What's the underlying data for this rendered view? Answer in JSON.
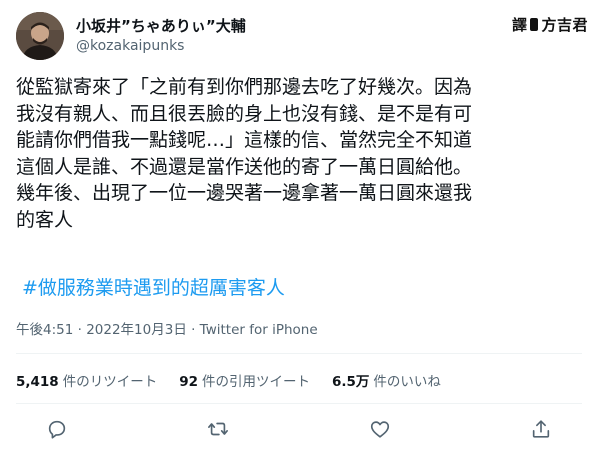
{
  "author": {
    "display_name": "小坂井”ちゃありぃ”大輔",
    "handle": "@kozakaipunks",
    "avatar_icon": "avatar-photo"
  },
  "watermark": {
    "prefix": "譯",
    "name": "方吉君"
  },
  "tweet": {
    "lines": [
      "從監獄寄來了「之前有到你們那邊去吃了好幾次。因為",
      "我沒有親人、而且很丟臉的身上也沒有錢、是不是有可",
      "能請你們借我一點錢呢…」這樣的信、當然完全不知道",
      "這個人是誰、不過還是當作送他的寄了一萬日圓給他。",
      "幾年後、出現了一位一邊哭著一邊拿著一萬日圓來還我",
      "的客人"
    ],
    "hashtag": "#做服務業時遇到的超厲害客人",
    "timestamp": "午後4:51 · 2022年10月3日 · Twitter for iPhone"
  },
  "stats": {
    "retweets_count": "5,418",
    "retweets_label": "件のリツイート",
    "quotes_count": "92",
    "quotes_label": "件の引用ツイート",
    "likes_count": "6.5万",
    "likes_label": "件のいいね"
  },
  "actions": [
    "reply-icon",
    "retweet-icon",
    "like-icon",
    "share-icon"
  ],
  "colors": {
    "link": "#1d9bf0",
    "muted": "#536471",
    "text": "#0f1419",
    "border": "#eff3f4"
  }
}
